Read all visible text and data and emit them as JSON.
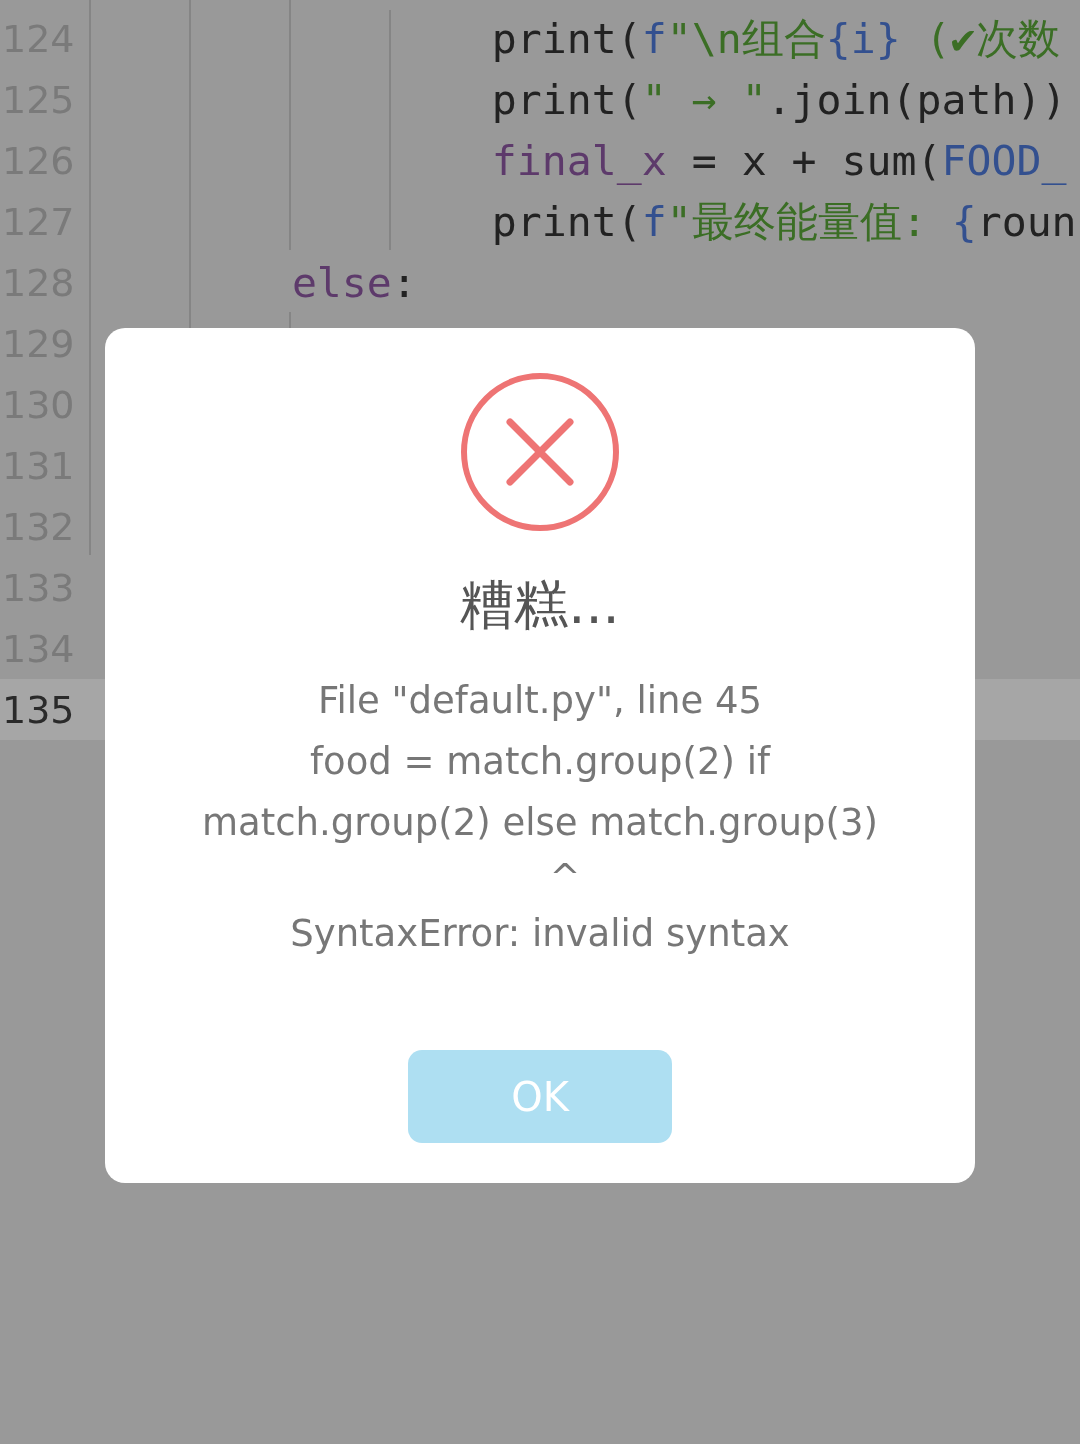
{
  "editor": {
    "lines": [
      {
        "number": "124",
        "current": false,
        "tokens": [
          {
            "kind": "plain",
            "text": "                print("
          },
          {
            "kind": "keyword",
            "text": "f"
          },
          {
            "kind": "string",
            "text": "\"\\n组合"
          },
          {
            "kind": "keyword",
            "text": "{i}"
          },
          {
            "kind": "string",
            "text": " (✔次数"
          }
        ]
      },
      {
        "number": "125",
        "current": false,
        "tokens": [
          {
            "kind": "plain",
            "text": "                print("
          },
          {
            "kind": "string",
            "text": "\" → \""
          },
          {
            "kind": "plain",
            "text": ".join(path))"
          }
        ]
      },
      {
        "number": "126",
        "current": false,
        "tokens": [
          {
            "kind": "variable",
            "text": "                final_x"
          },
          {
            "kind": "plain",
            "text": " = x + sum("
          },
          {
            "kind": "keyword",
            "text": "FOOD_"
          }
        ]
      },
      {
        "number": "127",
        "current": false,
        "tokens": [
          {
            "kind": "plain",
            "text": "                print("
          },
          {
            "kind": "keyword",
            "text": "f"
          },
          {
            "kind": "string",
            "text": "\"最终能量值: "
          },
          {
            "kind": "keyword",
            "text": "{"
          },
          {
            "kind": "plain",
            "text": "roun"
          }
        ]
      },
      {
        "number": "128",
        "current": false,
        "tokens": [
          {
            "kind": "variable",
            "text": "        else"
          },
          {
            "kind": "plain",
            "text": ":"
          }
        ]
      },
      {
        "number": "129",
        "current": false
      },
      {
        "number": "130",
        "current": false
      },
      {
        "number": "131",
        "current": false
      },
      {
        "number": "132",
        "current": false
      },
      {
        "number": "133",
        "current": false
      },
      {
        "number": "134",
        "current": false
      },
      {
        "number": "135",
        "current": true
      }
    ]
  },
  "dialog": {
    "title": "糟糕...",
    "message_lines": [
      "File \"default.py\", line 45",
      "food = match.group(2) if",
      "match.group(2) else match.group(3)",
      "^",
      "SyntaxError: invalid syntax"
    ],
    "button": "OK"
  }
}
